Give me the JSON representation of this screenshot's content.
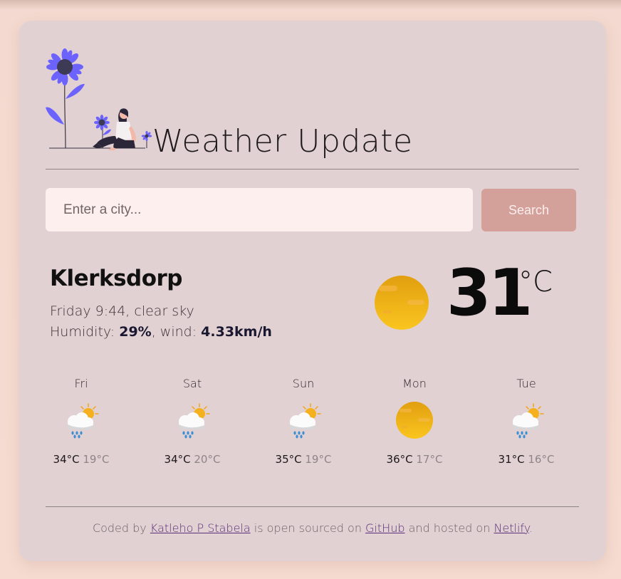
{
  "app": {
    "title": "Weather Update"
  },
  "search": {
    "placeholder": "Enter a city...",
    "button_label": "Search"
  },
  "current": {
    "city": "Klerksdorp",
    "day_time": "Friday 9:44",
    "description": "clear sky",
    "humidity_label": "Humidity:",
    "humidity_value": "29%",
    "wind_label": "wind:",
    "wind_value": "4.33km/h",
    "temperature": "31",
    "unit": "°C",
    "icon": "sun-icon"
  },
  "forecast": [
    {
      "day": "Fri",
      "max": "34°C",
      "min": "19°C",
      "icon": "sun-cloud-rain-icon"
    },
    {
      "day": "Sat",
      "max": "34°C",
      "min": "20°C",
      "icon": "sun-cloud-rain-icon"
    },
    {
      "day": "Sun",
      "max": "35°C",
      "min": "19°C",
      "icon": "sun-cloud-rain-icon"
    },
    {
      "day": "Mon",
      "max": "36°C",
      "min": "17°C",
      "icon": "sun-icon"
    },
    {
      "day": "Tue",
      "max": "31°C",
      "min": "16°C",
      "icon": "sun-cloud-rain-icon"
    }
  ],
  "footer": {
    "prefix": "Coded by",
    "author": "Katleho P Stabela",
    "middle": "is open sourced on",
    "github": "GitHub",
    "hosted": "and hosted on",
    "netlify": "Netlify",
    "suffix": "."
  },
  "colors": {
    "background": "#f3d9cf",
    "card": "#e2d1d3",
    "input": "#fdefee",
    "button": "#d4a09a",
    "accent_purple": "#6c63ff",
    "sun": "#f3b11a",
    "link": "#5b2f7a"
  }
}
